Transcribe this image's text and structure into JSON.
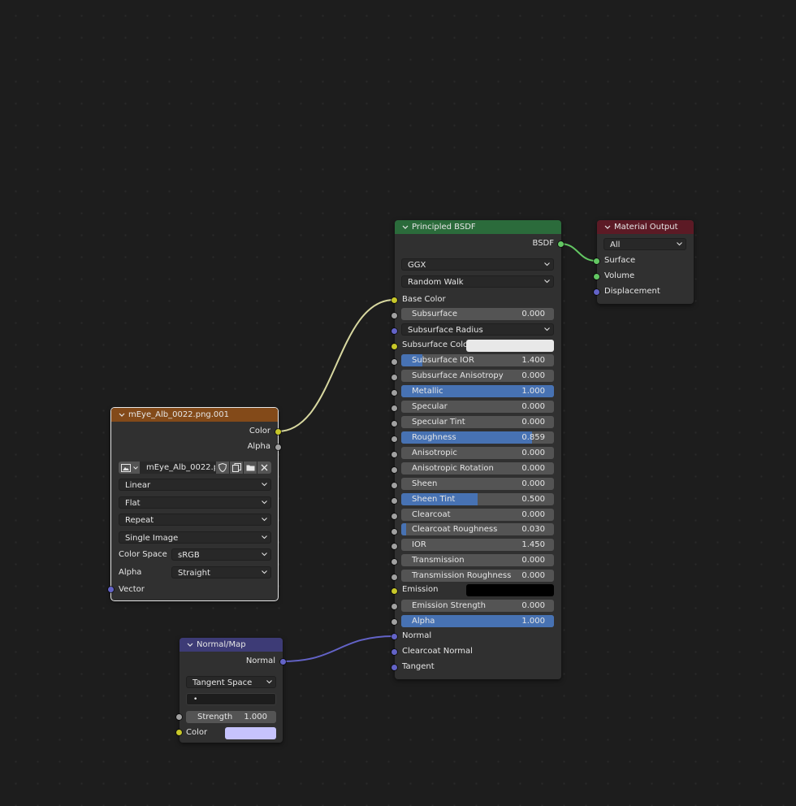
{
  "image_texture": {
    "title": "mEye_Alb_0022.png.001",
    "outputs": {
      "color": "Color",
      "alpha": "Alpha"
    },
    "image_name": "mEye_Alb_0022.p...",
    "interpolation": "Linear",
    "projection": "Flat",
    "extension": "Repeat",
    "source": "Single Image",
    "color_space_label": "Color Space",
    "color_space_value": "sRGB",
    "alpha_label": "Alpha",
    "alpha_value": "Straight",
    "vector_input": "Vector"
  },
  "normal_map": {
    "title": "Normal/Map",
    "output": "Normal",
    "space": "Tangent Space",
    "uv_map": "•",
    "strength": {
      "label": "Strength",
      "value": "1.000",
      "fill": 0
    },
    "color_label": "Color",
    "color_swatch": "#c6c3fd"
  },
  "principled": {
    "title": "Principled BSDF",
    "output": "BSDF",
    "distribution": "GGX",
    "subsurface_method": "Random Walk",
    "base_color": "Base Color",
    "subsurface": {
      "label": "Subsurface",
      "value": "0.000",
      "fill": 0
    },
    "subsurface_radius": "Subsurface Radius",
    "subsurface_color": "Subsurface Color",
    "subsurface_color_swatch": "#e8e8e8",
    "subsurface_ior": {
      "label": "Subsurface IOR",
      "value": "1.400",
      "fill": 0.14
    },
    "subsurface_anisotropy": {
      "label": "Subsurface Anisotropy",
      "value": "0.000",
      "fill": 0
    },
    "metallic": {
      "label": "Metallic",
      "value": "1.000",
      "fill": 1.0
    },
    "specular": {
      "label": "Specular",
      "value": "0.000",
      "fill": 0
    },
    "specular_tint": {
      "label": "Specular Tint",
      "value": "0.000",
      "fill": 0
    },
    "roughness": {
      "label": "Roughness",
      "value": "0.859",
      "fill": 0.859
    },
    "anisotropic": {
      "label": "Anisotropic",
      "value": "0.000",
      "fill": 0
    },
    "anisotropic_rotation": {
      "label": "Anisotropic Rotation",
      "value": "0.000",
      "fill": 0
    },
    "sheen": {
      "label": "Sheen",
      "value": "0.000",
      "fill": 0
    },
    "sheen_tint": {
      "label": "Sheen Tint",
      "value": "0.500",
      "fill": 0.5
    },
    "clearcoat": {
      "label": "Clearcoat",
      "value": "0.000",
      "fill": 0
    },
    "clearcoat_roughness": {
      "label": "Clearcoat Roughness",
      "value": "0.030",
      "fill": 0.03
    },
    "ior": {
      "label": "IOR",
      "value": "1.450",
      "fill": 0
    },
    "transmission": {
      "label": "Transmission",
      "value": "0.000",
      "fill": 0
    },
    "transmission_roughness": {
      "label": "Transmission Roughness",
      "value": "0.000",
      "fill": 0
    },
    "emission": "Emission",
    "emission_swatch": "#000000",
    "emission_strength": {
      "label": "Emission Strength",
      "value": "0.000",
      "fill": 0
    },
    "alpha": {
      "label": "Alpha",
      "value": "1.000",
      "fill": 1.0
    },
    "normal": "Normal",
    "clearcoat_normal": "Clearcoat Normal",
    "tangent": "Tangent"
  },
  "material_output": {
    "title": "Material Output",
    "target": "All",
    "surface": "Surface",
    "volume": "Volume",
    "displacement": "Displacement"
  },
  "colors": {
    "header_texture": "#834a19",
    "header_shader": "#2b6b3b",
    "header_vector": "#3d3b76",
    "header_output": "#5c1a25",
    "slider_fill": "#4772b3",
    "wire_color": "#d8d8a0",
    "wire_vector": "#6363c7",
    "wire_shader": "#63c763"
  }
}
